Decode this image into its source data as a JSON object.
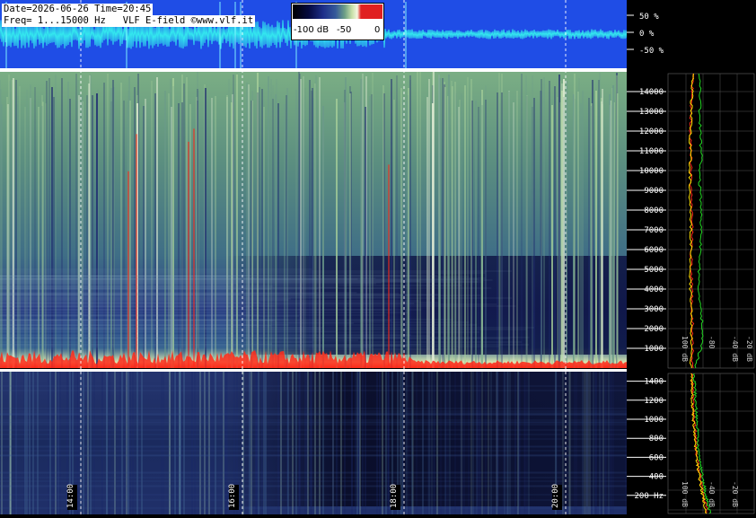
{
  "header": {
    "line1": "Date=2026-06-26 Time=20:45",
    "line2": "Freq= 1...15000 Hz   VLF E-field ©www.vlf.it"
  },
  "color_scale": {
    "labels": [
      "-100 dB",
      "-50",
      "0"
    ],
    "colors": [
      "#000000",
      "#1d2f8a",
      "#6fa086",
      "#f6f6e0",
      "#e02020"
    ]
  },
  "colors": {
    "waveform_bg": "#1f4de6",
    "waveform_trace": "#33e6ee",
    "spectrum_red": "#ff2a1a",
    "spectrum_yellow": "#ffe100",
    "spectrum_green": "#22d622"
  },
  "chart_data": [
    {
      "type": "line",
      "panel": "waveform",
      "ylabel_ticks": [
        "50 %",
        "0 %",
        "-50 %"
      ]
    },
    {
      "type": "heatmap",
      "panel": "spectrogram-wide",
      "ylim": [
        0,
        15000
      ],
      "y_ticks": [
        "14000",
        "13000",
        "12000",
        "11000",
        "10000",
        "9000",
        "8000",
        "7000",
        "6000",
        "5000",
        "4000",
        "3000",
        "2000",
        "1000"
      ],
      "x_ticks": [
        "14:00",
        "16:00",
        "18:00",
        "20:00"
      ]
    },
    {
      "type": "heatmap",
      "panel": "spectrogram-low",
      "ylim": [
        0,
        1500
      ],
      "y_ticks": [
        "1400",
        "1200",
        "1000",
        "800",
        "600",
        "400",
        "200 Hz"
      ]
    },
    {
      "type": "line",
      "panel": "spectrum-wide",
      "x_ticks": [
        "100 dB",
        "-80",
        "-40 dB",
        "-20 dB"
      ],
      "series": [
        {
          "color": "#ff2a1a",
          "values": [
            -73,
            -72,
            -72,
            -73,
            -73,
            -74,
            -73,
            -73,
            -74,
            -74,
            -74,
            -75,
            -74,
            -73,
            -72
          ]
        },
        {
          "color": "#ffe100",
          "values": [
            -74,
            -74,
            -73,
            -74,
            -75,
            -75,
            -74,
            -74,
            -75,
            -75,
            -75,
            -75,
            -74,
            -73,
            -72
          ]
        },
        {
          "color": "#22d622",
          "values": [
            -70,
            -62,
            -61,
            -63,
            -65,
            -64,
            -63,
            -62,
            -63,
            -64,
            -62,
            -63,
            -64,
            -63,
            -64
          ]
        }
      ]
    },
    {
      "type": "line",
      "panel": "spectrum-low",
      "x_ticks": [
        "100 dB",
        "-40 dB",
        "-20 dB"
      ],
      "series": [
        {
          "color": "#ff2a1a",
          "values": [
            -55,
            -60,
            -64,
            -68,
            -69,
            -71,
            -72,
            -73
          ]
        },
        {
          "color": "#ffe100",
          "values": [
            -56,
            -61,
            -65,
            -68,
            -70,
            -72,
            -73,
            -74
          ]
        },
        {
          "color": "#22d622",
          "values": [
            -52,
            -57,
            -61,
            -65,
            -66,
            -68,
            -69,
            -71
          ]
        }
      ]
    }
  ]
}
